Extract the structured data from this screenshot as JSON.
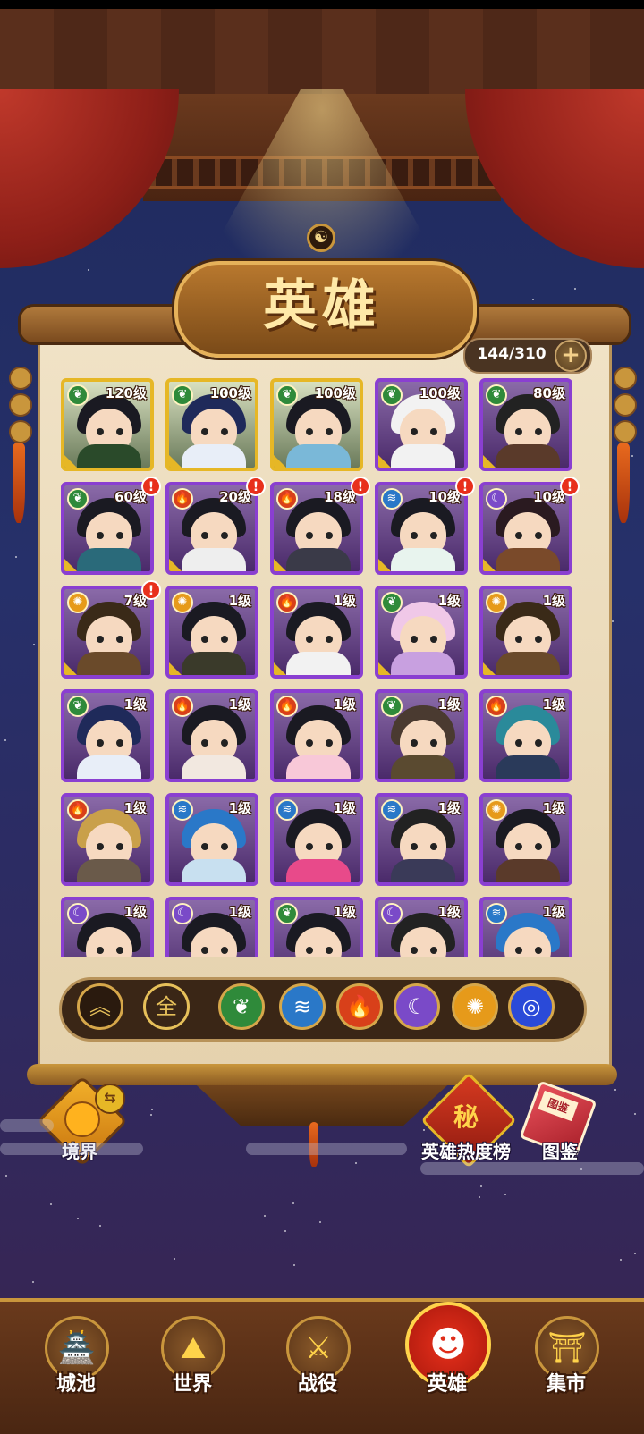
{
  "header": {
    "title": "英雄"
  },
  "hero_count": {
    "value": "144/310",
    "add_label": "+"
  },
  "heroes": [
    {
      "level": "120级",
      "element": "wood",
      "frame": "gold",
      "alert": false
    },
    {
      "level": "100级",
      "element": "wood",
      "frame": "gold",
      "alert": false
    },
    {
      "level": "100级",
      "element": "wood",
      "frame": "gold",
      "alert": false
    },
    {
      "level": "100级",
      "element": "wood",
      "frame": "purple",
      "alert": false
    },
    {
      "level": "80级",
      "element": "wood",
      "frame": "purple",
      "alert": false
    },
    {
      "level": "60级",
      "element": "wood",
      "frame": "purple",
      "alert": true
    },
    {
      "level": "20级",
      "element": "fire",
      "frame": "purple",
      "alert": true
    },
    {
      "level": "18级",
      "element": "fire",
      "frame": "purple",
      "alert": true
    },
    {
      "level": "10级",
      "element": "water",
      "frame": "purple",
      "alert": true
    },
    {
      "level": "10级",
      "element": "moon",
      "frame": "purple",
      "alert": true
    },
    {
      "level": "7级",
      "element": "sun",
      "frame": "purple",
      "alert": true
    },
    {
      "level": "1级",
      "element": "sun",
      "frame": "purple",
      "alert": false
    },
    {
      "level": "1级",
      "element": "fire",
      "frame": "purple",
      "alert": false
    },
    {
      "level": "1级",
      "element": "wood",
      "frame": "purple",
      "alert": false
    },
    {
      "level": "1级",
      "element": "sun",
      "frame": "purple",
      "alert": false
    },
    {
      "level": "1级",
      "element": "wood",
      "frame": "purple",
      "alert": false
    },
    {
      "level": "1级",
      "element": "fire",
      "frame": "purple",
      "alert": false
    },
    {
      "level": "1级",
      "element": "fire",
      "frame": "purple",
      "alert": false
    },
    {
      "level": "1级",
      "element": "wood",
      "frame": "purple",
      "alert": false
    },
    {
      "level": "1级",
      "element": "fire",
      "frame": "purple",
      "alert": false
    },
    {
      "level": "1级",
      "element": "fire",
      "frame": "purple",
      "alert": false
    },
    {
      "level": "1级",
      "element": "water",
      "frame": "purple",
      "alert": false
    },
    {
      "level": "1级",
      "element": "water",
      "frame": "purple",
      "alert": false
    },
    {
      "level": "1级",
      "element": "water",
      "frame": "purple",
      "alert": false
    },
    {
      "level": "1级",
      "element": "sun",
      "frame": "purple",
      "alert": false
    },
    {
      "level": "1级",
      "element": "moon",
      "frame": "purple",
      "alert": false
    },
    {
      "level": "1级",
      "element": "moon",
      "frame": "purple",
      "alert": false
    },
    {
      "level": "1级",
      "element": "wood",
      "frame": "purple",
      "alert": false
    },
    {
      "level": "1级",
      "element": "moon",
      "frame": "purple",
      "alert": false
    },
    {
      "level": "1级",
      "element": "water",
      "frame": "purple",
      "alert": false
    }
  ],
  "element_colors": {
    "wood": "#2f8a3a",
    "fire": "#d8401a",
    "water": "#2a78c8",
    "moon": "#7a4ac8",
    "sun": "#e69a1a",
    "storm": "#2a4ad8"
  },
  "filters": [
    {
      "name": "sort",
      "label": "︽"
    },
    {
      "name": "all",
      "label": "全"
    },
    {
      "name": "wood",
      "label": "❦"
    },
    {
      "name": "water",
      "label": "≋"
    },
    {
      "name": "fire",
      "label": "🔥"
    },
    {
      "name": "moon",
      "label": "☾"
    },
    {
      "name": "sun",
      "label": "✺"
    },
    {
      "name": "storm",
      "label": "◎"
    }
  ],
  "side_buttons": {
    "realm": "境界",
    "ranking": "英雄热度榜",
    "ranking_glyph": "秘",
    "atlas": "图鉴",
    "atlas_glyph": "图鉴",
    "swap_glyph": "⇆"
  },
  "bottom_nav": [
    {
      "label": "城池",
      "icon": "city-icon",
      "glyph": "🏯",
      "active": false
    },
    {
      "label": "世界",
      "icon": "world-icon",
      "glyph": "⛰",
      "active": false
    },
    {
      "label": "战役",
      "icon": "battle-icon",
      "glyph": "⚔",
      "active": false
    },
    {
      "label": "英雄",
      "icon": "hero-icon",
      "glyph": "☻",
      "active": true
    },
    {
      "label": "集市",
      "icon": "market-icon",
      "glyph": "⛩",
      "active": false
    }
  ]
}
